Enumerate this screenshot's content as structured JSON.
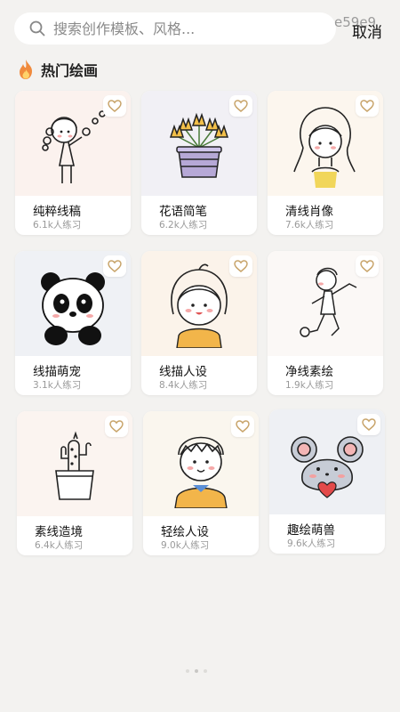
{
  "search": {
    "placeholder": "搜索创作模板、风格...",
    "cancel_label": "取消",
    "overlay_text": "e59e9"
  },
  "section": {
    "title": "热门绘画"
  },
  "cards": [
    {
      "title": "纯粹线稿",
      "count": "6.1k人练习",
      "icon": "girl-blowing-bubbles-drawing",
      "bg": "#fbf2ee"
    },
    {
      "title": "花语简笔",
      "count": "6.2k人练习",
      "icon": "flower-pot-drawing",
      "bg": "#f1f0f5"
    },
    {
      "title": "清线肖像",
      "count": "7.6k人练习",
      "icon": "girl-portrait-drawing",
      "bg": "#fcf6ee"
    },
    {
      "title": "线描萌宠",
      "count": "3.1k人练习",
      "icon": "panda-drawing",
      "bg": "#eff1f5"
    },
    {
      "title": "线描人设",
      "count": "8.4k人练习",
      "icon": "bob-hair-girl-drawing",
      "bg": "#fbf3ea"
    },
    {
      "title": "净线素绘",
      "count": "1.9k人练习",
      "icon": "running-boy-sketch",
      "bg": "#fbf8f6"
    },
    {
      "title": "素线造境",
      "count": "6.4k人练习",
      "icon": "cactus-pot-drawing",
      "bg": "#fbf4f0"
    },
    {
      "title": "轻绘人设",
      "count": "9.0k人练习",
      "icon": "boy-character-drawing",
      "bg": "#faf6ee"
    },
    {
      "title": "趣绘萌兽",
      "count": "9.6k人练习",
      "icon": "mouse-with-heart-drawing",
      "bg": "#eef0f4"
    }
  ],
  "colors": {
    "accent_heart": "#c8a46a",
    "fire": "#f08a3c",
    "background": "#f3f2f0"
  }
}
